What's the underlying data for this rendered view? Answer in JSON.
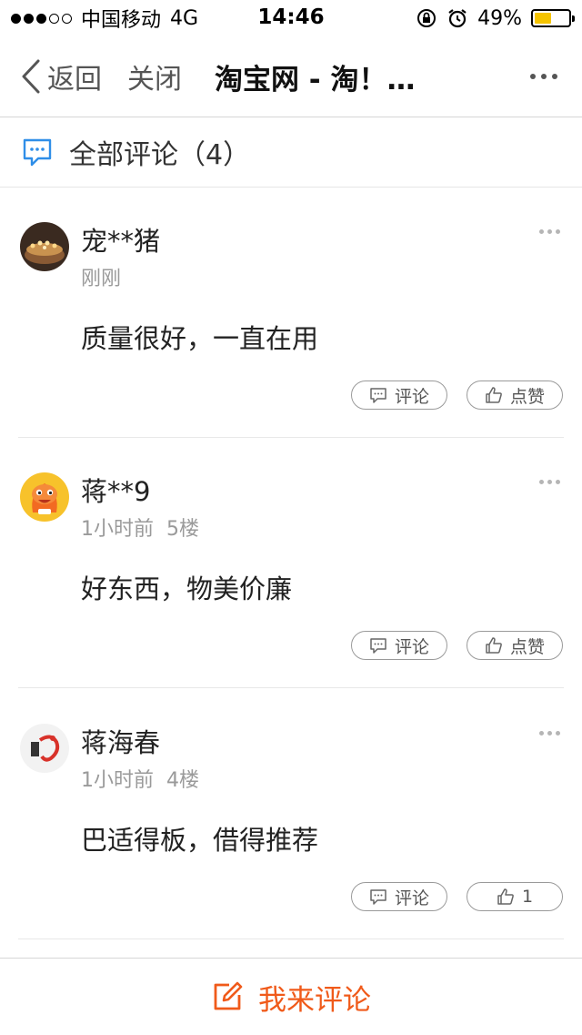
{
  "status_bar": {
    "carrier": "中国移动",
    "network": "4G",
    "time": "14:46",
    "battery": "49%",
    "battery_level": 0.49,
    "battery_color": "#f5c400"
  },
  "nav": {
    "back_label": "返回",
    "close_label": "关闭",
    "title": "淘宝网 - 淘！…"
  },
  "comments_header": {
    "title": "全部评论（4）",
    "icon": "chat-bubble-icon"
  },
  "comments": [
    {
      "name": "宠**猪",
      "time": "刚刚",
      "floor": "",
      "text": "质量很好，一直在用",
      "comment_label": "评论",
      "like_label": "点赞"
    },
    {
      "name": "蒋**9",
      "time": "1小时前",
      "floor": "5楼",
      "text": "好东西，物美价廉",
      "comment_label": "评论",
      "like_label": "点赞"
    },
    {
      "name": "蒋海春",
      "time": "1小时前",
      "floor": "4楼",
      "text": "巴适得板，借得推荐",
      "comment_label": "评论",
      "like_label": "1"
    }
  ],
  "bottom_bar": {
    "label": "我来评论",
    "accent": "#f05a1a"
  }
}
